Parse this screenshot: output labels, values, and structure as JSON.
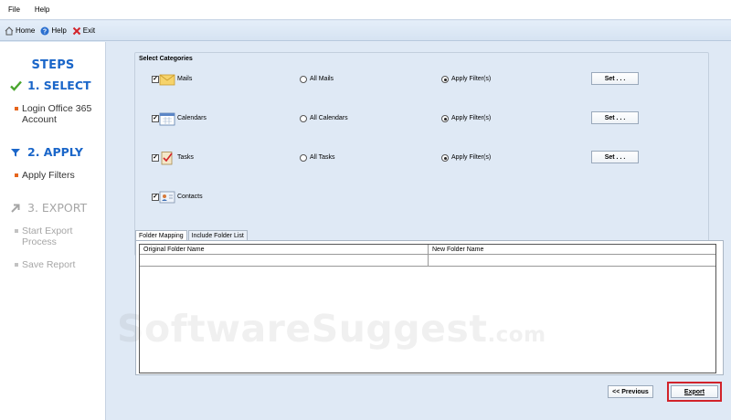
{
  "menu": {
    "items": [
      "File",
      "Help"
    ]
  },
  "toolbar": {
    "home": {
      "label": "Home",
      "icon": "home-icon"
    },
    "help": {
      "label": "Help",
      "icon": "help-icon"
    },
    "exit": {
      "label": "Exit",
      "icon": "exit-icon"
    }
  },
  "sidebar": {
    "title": "STEPS",
    "steps": [
      {
        "label": "1. SELECT",
        "state": "done",
        "icon": "checkmark-icon",
        "subs": [
          "Login Office 365 Account"
        ]
      },
      {
        "label": "2. APPLY",
        "state": "active",
        "icon": "filter-icon",
        "subs": [
          "Apply Filters"
        ]
      },
      {
        "label": "3. EXPORT",
        "state": "inactive",
        "icon": "export-arrow-icon",
        "subs": [
          "Start Export Process",
          "Save Report"
        ]
      }
    ]
  },
  "categories": {
    "title": "Select Categories",
    "items": [
      {
        "label": "Mails",
        "checked": true,
        "all_label": "All Mails",
        "filter_label": "Apply Filter(s)",
        "selected": "filter",
        "set_label": "Set . . ."
      },
      {
        "label": "Calendars",
        "checked": true,
        "all_label": "All Calendars",
        "filter_label": "Apply Filter(s)",
        "selected": "filter",
        "set_label": "Set . . ."
      },
      {
        "label": "Tasks",
        "checked": true,
        "all_label": "All Tasks",
        "filter_label": "Apply Filter(s)",
        "selected": "filter",
        "set_label": "Set . . ."
      },
      {
        "label": "Contacts",
        "checked": true
      }
    ]
  },
  "tabs": [
    "Folder Mapping",
    "Include Folder List"
  ],
  "grid": {
    "columns": [
      "Original Folder Name",
      "New Folder Name"
    ]
  },
  "buttons": {
    "previous": "<< Previous",
    "export": "Export"
  },
  "watermark": {
    "main": "SoftwareSuggest",
    "suffix": ".com"
  },
  "colors": {
    "accent": "#1a66c9",
    "bullet": "#e6651c",
    "highlight": "#d2232a",
    "background": "#dfe9f5"
  }
}
